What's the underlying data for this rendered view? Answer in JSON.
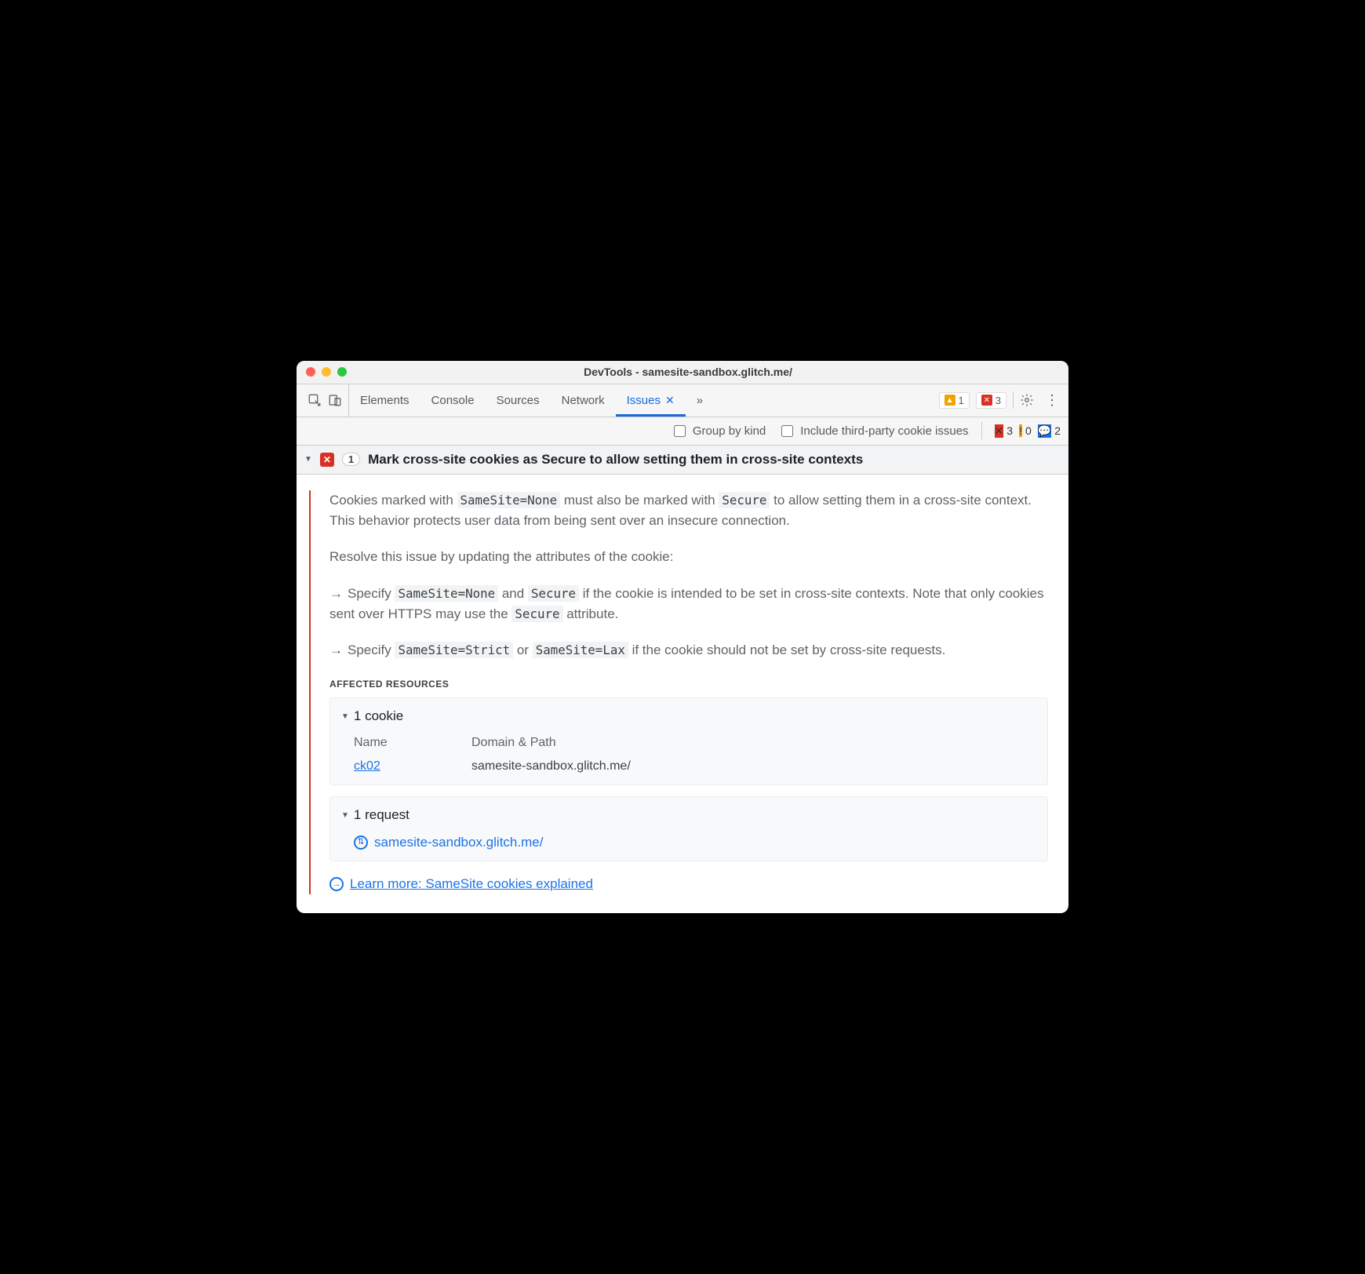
{
  "window": {
    "title": "DevTools - samesite-sandbox.glitch.me/"
  },
  "tabs": {
    "items": [
      "Elements",
      "Console",
      "Sources",
      "Network",
      "Issues"
    ],
    "active": "Issues"
  },
  "badges": {
    "warn_count": "1",
    "error_count": "3"
  },
  "filterbar": {
    "group_by_kind": "Group by kind",
    "third_party": "Include third-party cookie issues",
    "counts": {
      "errors": "3",
      "info": "0",
      "chat": "2"
    }
  },
  "issue": {
    "count": "1",
    "title": "Mark cross-site cookies as Secure to allow setting them in cross-site contexts",
    "desc1_pre": "Cookies marked with ",
    "desc1_code1": "SameSite=None",
    "desc1_mid": " must also be marked with ",
    "desc1_code2": "Secure",
    "desc1_post": " to allow setting them in a cross-site context. This behavior protects user data from being sent over an insecure connection.",
    "desc2": "Resolve this issue by updating the attributes of the cookie:",
    "bullet1_pre": "Specify ",
    "bullet1_code1": "SameSite=None",
    "bullet1_mid": " and ",
    "bullet1_code2": "Secure",
    "bullet1_post1": " if the cookie is intended to be set in cross-site contexts. Note that only cookies sent over HTTPS may use the ",
    "bullet1_code3": "Secure",
    "bullet1_post2": " attribute.",
    "bullet2_pre": "Specify ",
    "bullet2_code1": "SameSite=Strict",
    "bullet2_mid": " or ",
    "bullet2_code2": "SameSite=Lax",
    "bullet2_post": " if the cookie should not be set by cross-site requests.",
    "affected_label": "Affected Resources",
    "cookie_section": "1 cookie",
    "col_name": "Name",
    "col_domain": "Domain & Path",
    "cookie_name": "ck02",
    "cookie_domain": "samesite-sandbox.glitch.me/",
    "request_section": "1 request",
    "request_url": "samesite-sandbox.glitch.me/",
    "learn_more": "Learn more: SameSite cookies explained"
  }
}
